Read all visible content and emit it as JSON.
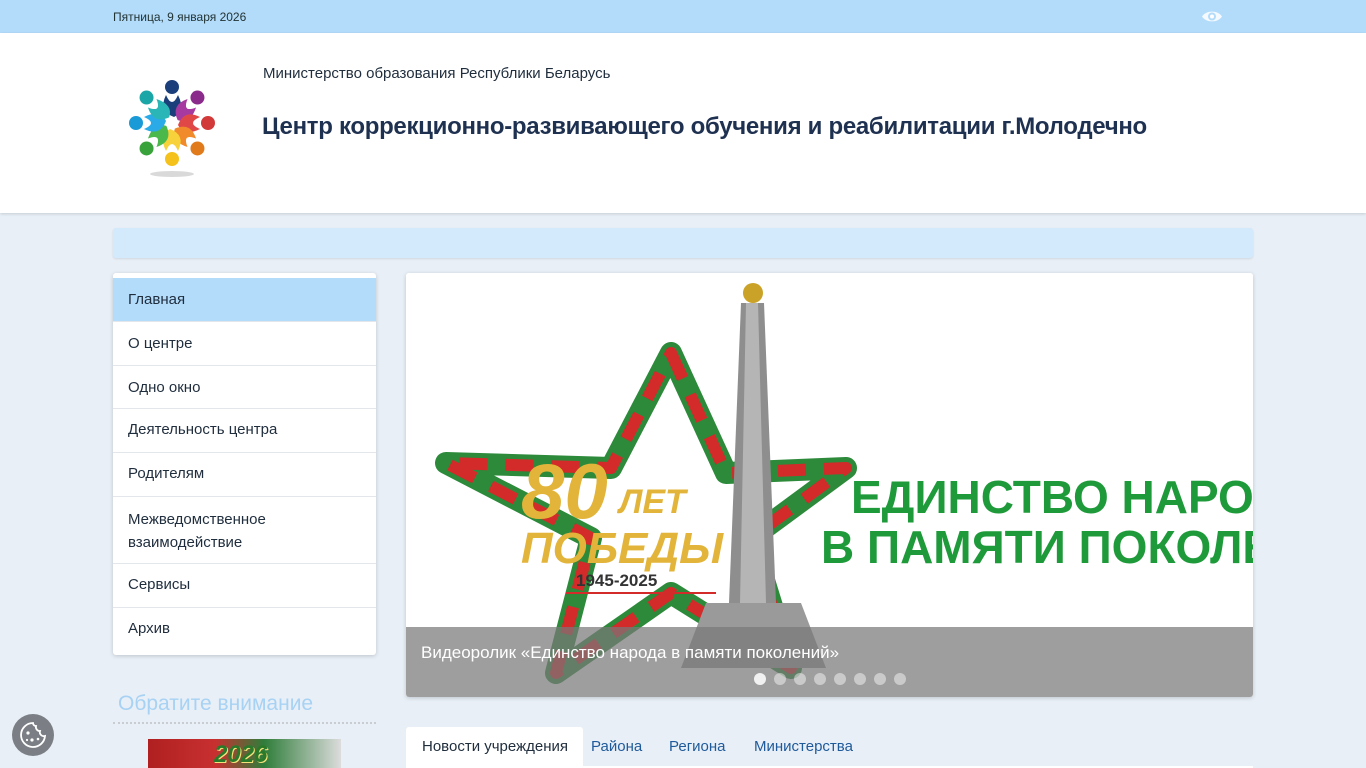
{
  "topbar": {
    "date": "Пятница, 9 января 2026",
    "accessibility_icon": "eye-icon"
  },
  "header": {
    "ministry": "Министерство образования Республики Беларусь",
    "title": "Центр коррекционно-развивающего обучения и реабилитации г.Молодечно",
    "logo_icon": "colorful-people-logo"
  },
  "sidebar": {
    "items": [
      {
        "label": "Главная",
        "active": true
      },
      {
        "label": "О центре"
      },
      {
        "label": "Одно окно"
      },
      {
        "label": "Деятельность центра"
      },
      {
        "label": "Родителям"
      },
      {
        "label": "Межведомственное",
        "label2": "взаимодействие"
      },
      {
        "label": "Сервисы"
      },
      {
        "label": "Архив"
      }
    ],
    "attention_title": "Обратите внимание",
    "banner_text": "2026"
  },
  "slider": {
    "badge": "80",
    "badge_sub": "ЛЕТ",
    "badge_word": "ПОБЕДЫ",
    "years": "1945-2025",
    "headline_line1": "ЕДИНСТВО НАРОДА",
    "headline_line2": "В ПАМЯТИ ПОКОЛЕНИЙ",
    "caption": "Видеоролик «Единство народа в памяти поколений»",
    "slide_count": 8,
    "active_slide": 1
  },
  "tabs": [
    {
      "label": "Новости учреждения",
      "active": true
    },
    {
      "label": "Района"
    },
    {
      "label": "Региона"
    },
    {
      "label": "Министерства"
    }
  ],
  "cookie_icon": "cookie-icon",
  "colors": {
    "topbar": "#b3dcfb",
    "active_menu": "#b3dcfb",
    "title": "#1f3150",
    "attention": "#a8d2f3",
    "star_red": "#d32a2a",
    "star_green": "#2c8a3a"
  }
}
